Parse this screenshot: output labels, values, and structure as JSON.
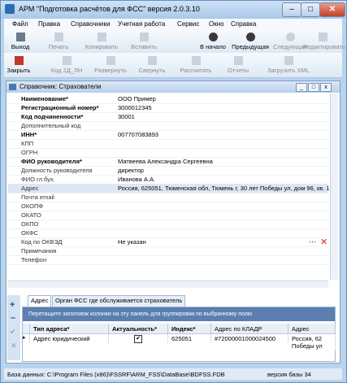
{
  "window": {
    "title": "АРМ \"Подготовка расчётов для ФСС\"   версия 2.0.3.10"
  },
  "menu": [
    "Файл",
    "Правка",
    "Справочники",
    "Учетная работа",
    "Сервис",
    "Окно",
    "Справка"
  ],
  "toolbar1": {
    "items": [
      "Выход",
      "Печать",
      "Копировать",
      "Вставить",
      "В начало",
      "Предыдущая",
      "Следующая",
      "Редактировать"
    ]
  },
  "toolbar2": {
    "items": [
      "Закрыть",
      "Код 2Д_ЛН",
      "Развернуть",
      "Свернуть",
      "Рассчитать",
      "Отчеты",
      "Загрузить XML"
    ]
  },
  "panel": {
    "title": "Справочник: Страхователи"
  },
  "form": {
    "rows": [
      {
        "label": "Наименование*",
        "value": "ООО Пример",
        "bold": true
      },
      {
        "label": "Регистрационный номер*",
        "value": "3000012345",
        "bold": true
      },
      {
        "label": "Код подчиненности*",
        "value": "30001",
        "bold": true
      },
      {
        "label": "Дополнительный код",
        "value": "",
        "bold": false
      },
      {
        "label": "ИНН*",
        "value": "007707083893",
        "bold": true
      },
      {
        "label": "КПП",
        "value": "",
        "bold": false
      },
      {
        "label": "ОГРН",
        "value": "",
        "bold": false
      },
      {
        "label": "ФИО руководителя*",
        "value": "Матвеева Александра Сергеевна",
        "bold": true
      },
      {
        "label": "Должность руководителя",
        "value": "директор",
        "bold": false
      },
      {
        "label": "ФИО гл.бух.",
        "value": "Иванова А.А.",
        "bold": false
      },
      {
        "label": "Адрес",
        "value": "Россия, 625051, Тюменская обл, Тюмень г, 30 лет Победы ул, дом 96, кв. 1",
        "bold": false
      },
      {
        "label": "Почта email",
        "value": "",
        "bold": false
      },
      {
        "label": "ОКОПФ",
        "value": "",
        "bold": false
      },
      {
        "label": "ОКАТО",
        "value": "",
        "bold": false
      },
      {
        "label": "ОКПО",
        "value": "",
        "bold": false
      },
      {
        "label": "ОКФС",
        "value": "",
        "bold": false
      },
      {
        "label": "Код по ОКВЭД",
        "value": "Не указан",
        "bold": false
      },
      {
        "label": "Примечания",
        "value": "",
        "bold": false
      },
      {
        "label": "Телефон",
        "value": "",
        "bold": false
      }
    ]
  },
  "tabs": [
    "Адрес",
    "Орган ФСС где обслуживается страхователь"
  ],
  "grid": {
    "hint": "Перетащите заголовок колонки на эту панель для группировки по выбранному полю",
    "columns": [
      "Тип адреса*",
      "Актуальность*",
      "Индекс*",
      "Адрес по КЛАДР",
      "Адрес"
    ],
    "row": {
      "type": "Адрес юридический",
      "actual": "✔",
      "index": "625051",
      "kladr": "#72000001000024500",
      "address": "Россия, 62 Победы ул"
    }
  },
  "status": {
    "db": "База данных: C:\\Program Files (x86)\\FSSRF\\ARM_FSS\\DataBase\\BDFSS.FDB",
    "version": "версия базы 34"
  },
  "colors": {
    "accent": "#5a7fb0",
    "titlebar": "#b8d3ec"
  }
}
